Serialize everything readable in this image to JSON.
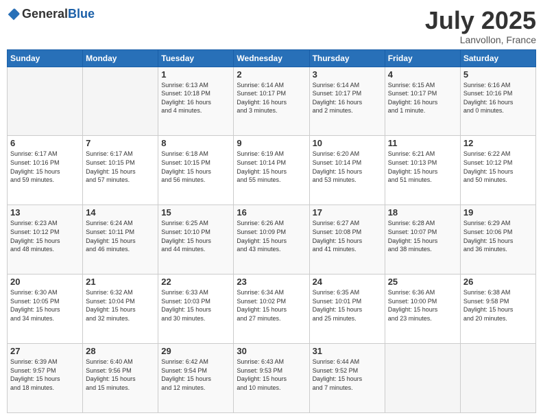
{
  "logo": {
    "general": "General",
    "blue": "Blue"
  },
  "header": {
    "month": "July 2025",
    "location": "Lanvollon, France"
  },
  "weekdays": [
    "Sunday",
    "Monday",
    "Tuesday",
    "Wednesday",
    "Thursday",
    "Friday",
    "Saturday"
  ],
  "weeks": [
    [
      {
        "day": "",
        "info": ""
      },
      {
        "day": "",
        "info": ""
      },
      {
        "day": "1",
        "info": "Sunrise: 6:13 AM\nSunset: 10:18 PM\nDaylight: 16 hours\nand 4 minutes."
      },
      {
        "day": "2",
        "info": "Sunrise: 6:14 AM\nSunset: 10:17 PM\nDaylight: 16 hours\nand 3 minutes."
      },
      {
        "day": "3",
        "info": "Sunrise: 6:14 AM\nSunset: 10:17 PM\nDaylight: 16 hours\nand 2 minutes."
      },
      {
        "day": "4",
        "info": "Sunrise: 6:15 AM\nSunset: 10:17 PM\nDaylight: 16 hours\nand 1 minute."
      },
      {
        "day": "5",
        "info": "Sunrise: 6:16 AM\nSunset: 10:16 PM\nDaylight: 16 hours\nand 0 minutes."
      }
    ],
    [
      {
        "day": "6",
        "info": "Sunrise: 6:17 AM\nSunset: 10:16 PM\nDaylight: 15 hours\nand 59 minutes."
      },
      {
        "day": "7",
        "info": "Sunrise: 6:17 AM\nSunset: 10:15 PM\nDaylight: 15 hours\nand 57 minutes."
      },
      {
        "day": "8",
        "info": "Sunrise: 6:18 AM\nSunset: 10:15 PM\nDaylight: 15 hours\nand 56 minutes."
      },
      {
        "day": "9",
        "info": "Sunrise: 6:19 AM\nSunset: 10:14 PM\nDaylight: 15 hours\nand 55 minutes."
      },
      {
        "day": "10",
        "info": "Sunrise: 6:20 AM\nSunset: 10:14 PM\nDaylight: 15 hours\nand 53 minutes."
      },
      {
        "day": "11",
        "info": "Sunrise: 6:21 AM\nSunset: 10:13 PM\nDaylight: 15 hours\nand 51 minutes."
      },
      {
        "day": "12",
        "info": "Sunrise: 6:22 AM\nSunset: 10:12 PM\nDaylight: 15 hours\nand 50 minutes."
      }
    ],
    [
      {
        "day": "13",
        "info": "Sunrise: 6:23 AM\nSunset: 10:12 PM\nDaylight: 15 hours\nand 48 minutes."
      },
      {
        "day": "14",
        "info": "Sunrise: 6:24 AM\nSunset: 10:11 PM\nDaylight: 15 hours\nand 46 minutes."
      },
      {
        "day": "15",
        "info": "Sunrise: 6:25 AM\nSunset: 10:10 PM\nDaylight: 15 hours\nand 44 minutes."
      },
      {
        "day": "16",
        "info": "Sunrise: 6:26 AM\nSunset: 10:09 PM\nDaylight: 15 hours\nand 43 minutes."
      },
      {
        "day": "17",
        "info": "Sunrise: 6:27 AM\nSunset: 10:08 PM\nDaylight: 15 hours\nand 41 minutes."
      },
      {
        "day": "18",
        "info": "Sunrise: 6:28 AM\nSunset: 10:07 PM\nDaylight: 15 hours\nand 38 minutes."
      },
      {
        "day": "19",
        "info": "Sunrise: 6:29 AM\nSunset: 10:06 PM\nDaylight: 15 hours\nand 36 minutes."
      }
    ],
    [
      {
        "day": "20",
        "info": "Sunrise: 6:30 AM\nSunset: 10:05 PM\nDaylight: 15 hours\nand 34 minutes."
      },
      {
        "day": "21",
        "info": "Sunrise: 6:32 AM\nSunset: 10:04 PM\nDaylight: 15 hours\nand 32 minutes."
      },
      {
        "day": "22",
        "info": "Sunrise: 6:33 AM\nSunset: 10:03 PM\nDaylight: 15 hours\nand 30 minutes."
      },
      {
        "day": "23",
        "info": "Sunrise: 6:34 AM\nSunset: 10:02 PM\nDaylight: 15 hours\nand 27 minutes."
      },
      {
        "day": "24",
        "info": "Sunrise: 6:35 AM\nSunset: 10:01 PM\nDaylight: 15 hours\nand 25 minutes."
      },
      {
        "day": "25",
        "info": "Sunrise: 6:36 AM\nSunset: 10:00 PM\nDaylight: 15 hours\nand 23 minutes."
      },
      {
        "day": "26",
        "info": "Sunrise: 6:38 AM\nSunset: 9:58 PM\nDaylight: 15 hours\nand 20 minutes."
      }
    ],
    [
      {
        "day": "27",
        "info": "Sunrise: 6:39 AM\nSunset: 9:57 PM\nDaylight: 15 hours\nand 18 minutes."
      },
      {
        "day": "28",
        "info": "Sunrise: 6:40 AM\nSunset: 9:56 PM\nDaylight: 15 hours\nand 15 minutes."
      },
      {
        "day": "29",
        "info": "Sunrise: 6:42 AM\nSunset: 9:54 PM\nDaylight: 15 hours\nand 12 minutes."
      },
      {
        "day": "30",
        "info": "Sunrise: 6:43 AM\nSunset: 9:53 PM\nDaylight: 15 hours\nand 10 minutes."
      },
      {
        "day": "31",
        "info": "Sunrise: 6:44 AM\nSunset: 9:52 PM\nDaylight: 15 hours\nand 7 minutes."
      },
      {
        "day": "",
        "info": ""
      },
      {
        "day": "",
        "info": ""
      }
    ]
  ]
}
